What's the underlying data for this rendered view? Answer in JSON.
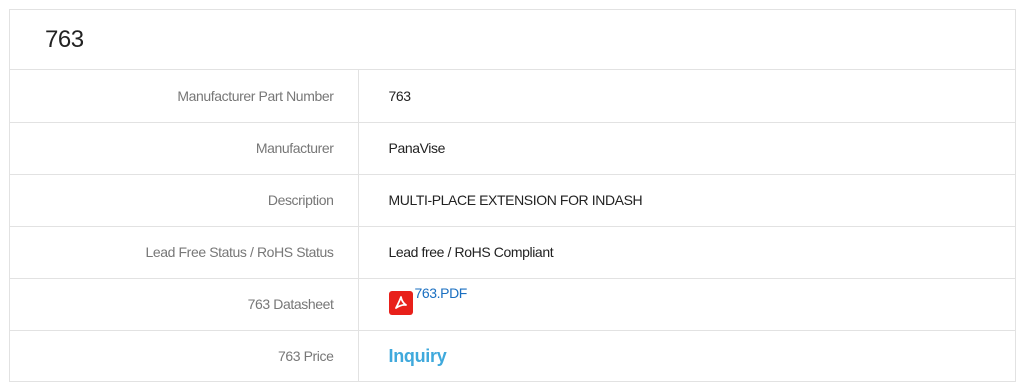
{
  "header": {
    "title": "763"
  },
  "specs": [
    {
      "label": "Manufacturer Part Number",
      "value": "763"
    },
    {
      "label": "Manufacturer",
      "value": "PanaVise"
    },
    {
      "label": "Description",
      "value": "MULTI-PLACE EXTENSION FOR INDASH"
    },
    {
      "label": "Lead Free Status / RoHS Status",
      "value": "Lead free / RoHS Compliant"
    },
    {
      "label": "763 Datasheet",
      "value": "763.PDF",
      "icon": "pdf-icon"
    },
    {
      "label": "763 Price",
      "value": "Inquiry"
    }
  ],
  "colors": {
    "link": "#1a6fc1",
    "inquiry": "#3fa9dc",
    "pdf_icon": "#e8201a",
    "border": "#e2e2e2",
    "label_text": "#777777"
  }
}
